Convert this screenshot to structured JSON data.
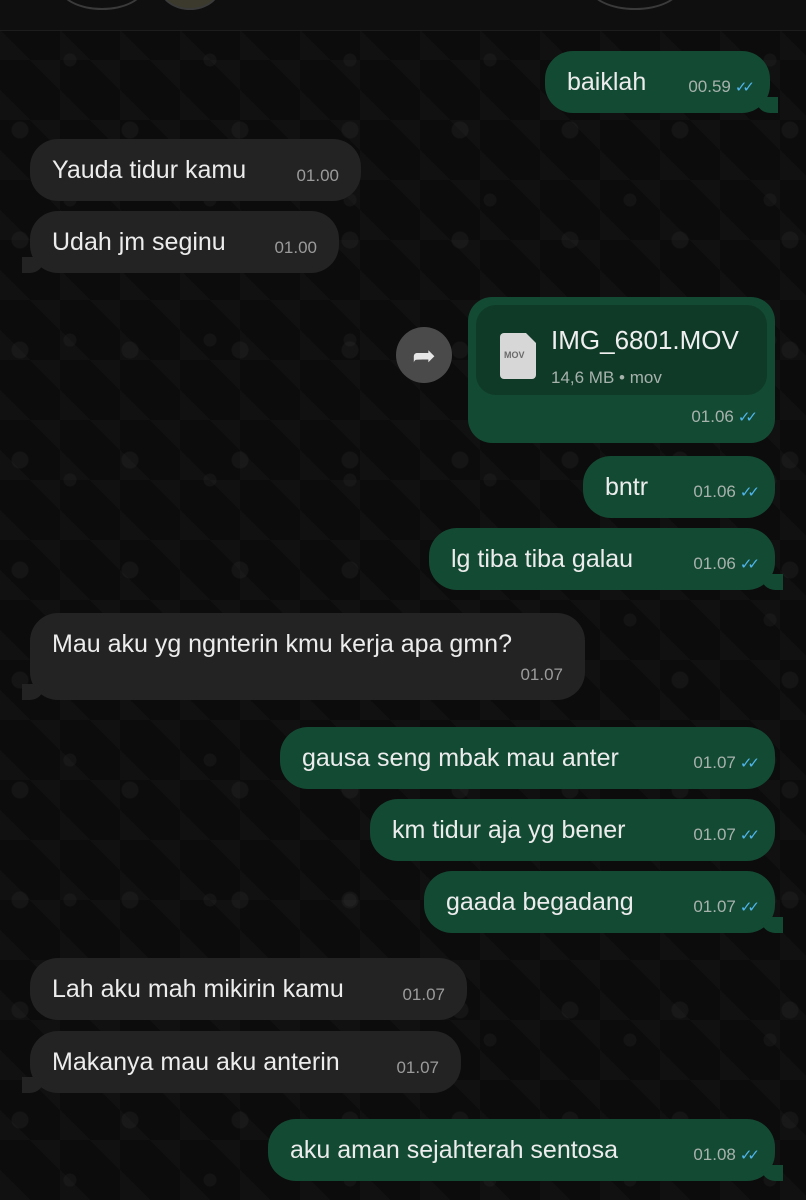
{
  "messages": [
    {
      "id": "m1",
      "dir": "out",
      "text": "baiklah",
      "time": "00.59"
    },
    {
      "id": "m2",
      "dir": "in",
      "text": "Yauda tidur kamu",
      "time": "01.00"
    },
    {
      "id": "m3",
      "dir": "in",
      "text": "Udah jm seginu",
      "time": "01.00"
    },
    {
      "id": "m4",
      "dir": "out",
      "type": "file",
      "file_name": "IMG_6801.MOV",
      "file_size": "14,6 MB",
      "file_type": "mov",
      "file_icon_label": "MOV",
      "time": "01.06"
    },
    {
      "id": "m5",
      "dir": "out",
      "text": "bntr",
      "time": "01.06"
    },
    {
      "id": "m6",
      "dir": "out",
      "text": "lg tiba tiba galau",
      "time": "01.06"
    },
    {
      "id": "m7",
      "dir": "in",
      "text": "Mau aku yg ngnterin kmu kerja apa gmn?",
      "time": "01.07"
    },
    {
      "id": "m8",
      "dir": "out",
      "text": "gausa seng mbak mau anter",
      "time": "01.07"
    },
    {
      "id": "m9",
      "dir": "out",
      "text": "km tidur aja yg bener",
      "time": "01.07"
    },
    {
      "id": "m10",
      "dir": "out",
      "text": "gaada begadang",
      "time": "01.07"
    },
    {
      "id": "m11",
      "dir": "in",
      "text": "Lah aku mah mikirin kamu",
      "time": "01.07"
    },
    {
      "id": "m12",
      "dir": "in",
      "text": "Makanya mau aku anterin",
      "time": "01.07"
    },
    {
      "id": "m13",
      "dir": "out",
      "text": "aku aman sejahterah sentosa",
      "time": "01.08"
    }
  ],
  "icons": {
    "forward": "forward-arrow-icon",
    "read_receipt": "double-check-icon",
    "file": "document-icon"
  },
  "colors": {
    "incoming_bubble": "#232323",
    "outgoing_bubble": "#134a33",
    "read_ticks": "#4fb5ec",
    "background": "#0b0b0b"
  }
}
